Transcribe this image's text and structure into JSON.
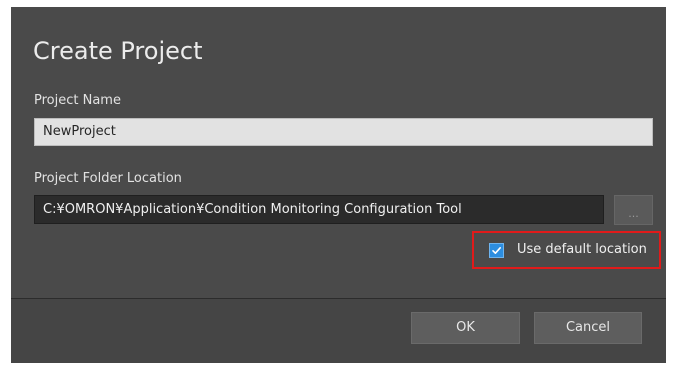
{
  "dialog": {
    "title": "Create Project",
    "project_name": {
      "label": "Project Name",
      "value": "NewProject"
    },
    "folder_location": {
      "label": "Project Folder Location",
      "value": "C:¥OMRON¥Application¥Condition Monitoring Configuration Tool",
      "browse_label": "..."
    },
    "default_location": {
      "label": "Use default location",
      "checked": true
    },
    "buttons": {
      "ok_label": "OK",
      "cancel_label": "Cancel"
    }
  },
  "colors": {
    "dialog_bg": "#4a4a4a",
    "accent_checkbox": "#2d8ee0",
    "highlight_border": "#e01a1a"
  }
}
